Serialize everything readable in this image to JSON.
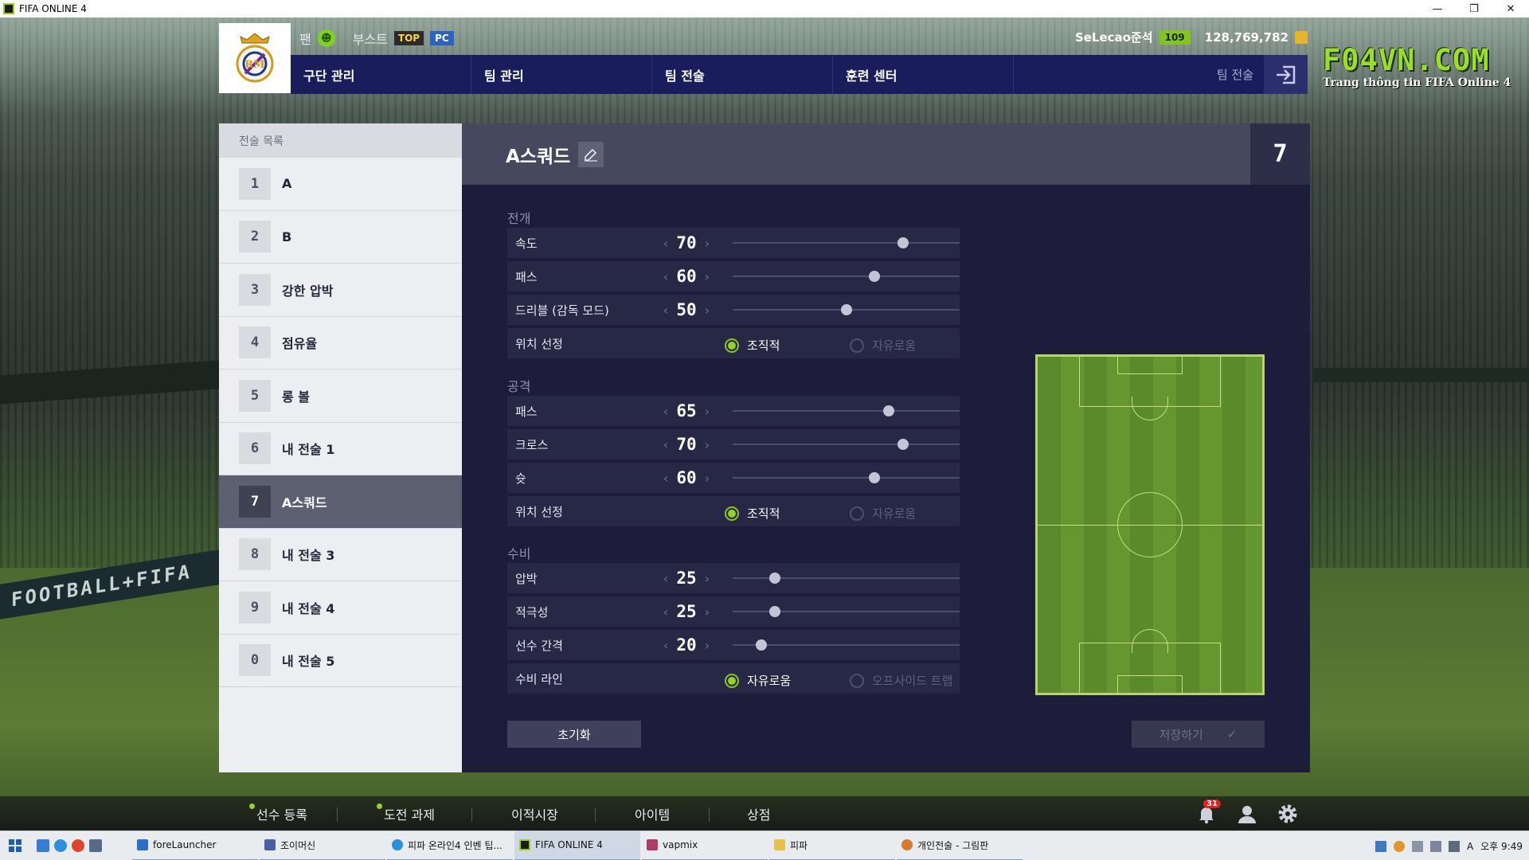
{
  "window": {
    "title": "FIFA ONLINE 4"
  },
  "header": {
    "fan_label": "팬",
    "boost_label": "부스트",
    "badge_top": "TOP",
    "badge_pc": "PC",
    "username": "SeLecao준석",
    "level": "109",
    "coins": "128,769,782",
    "nav": [
      "구단 관리",
      "팀 관리",
      "팀 전술",
      "훈련 센터"
    ],
    "nav_right": "팀 전술"
  },
  "brand": {
    "title": "F04VN.COM",
    "subtitle": "Trang thông tin FIFA Online 4"
  },
  "backdrop": {
    "board_text": "FOOTBALL+FIFA"
  },
  "tactic_list": {
    "header": "전술 목록",
    "items": [
      {
        "num": "1",
        "name": "A"
      },
      {
        "num": "2",
        "name": "B"
      },
      {
        "num": "3",
        "name": "강한 압박"
      },
      {
        "num": "4",
        "name": "점유율"
      },
      {
        "num": "5",
        "name": "롱 볼"
      },
      {
        "num": "6",
        "name": "내 전술 1"
      },
      {
        "num": "7",
        "name": "A스쿼드"
      },
      {
        "num": "8",
        "name": "내 전술 3"
      },
      {
        "num": "9",
        "name": "내 전술 4"
      },
      {
        "num": "0",
        "name": "내 전술 5"
      }
    ],
    "selected_index": 6
  },
  "main": {
    "title": "A스쿼드",
    "slot": "7",
    "sections": {
      "buildup": {
        "label": "전개",
        "rows": [
          {
            "label": "속도",
            "value": "70"
          },
          {
            "label": "패스",
            "value": "60"
          },
          {
            "label": "드리블 (감독 모드)",
            "value": "50"
          }
        ],
        "position": {
          "label": "위치 선정",
          "opt_on": "조직적",
          "opt_off": "자유로움"
        }
      },
      "attack": {
        "label": "공격",
        "rows": [
          {
            "label": "패스",
            "value": "65"
          },
          {
            "label": "크로스",
            "value": "70"
          },
          {
            "label": "슛",
            "value": "60"
          }
        ],
        "position": {
          "label": "위치 선정",
          "opt_on": "조직적",
          "opt_off": "자유로움"
        }
      },
      "defence": {
        "label": "수비",
        "rows": [
          {
            "label": "압박",
            "value": "25"
          },
          {
            "label": "적극성",
            "value": "25"
          },
          {
            "label": "선수 간격",
            "value": "20"
          }
        ],
        "line": {
          "label": "수비 라인",
          "opt_on": "자유로움",
          "opt_off": "오프사이드 트랩"
        }
      }
    },
    "reset_label": "초기화",
    "save_label": "저장하기"
  },
  "bottom_nav": {
    "items": [
      "선수 등록",
      "도전 과제",
      "이적시장",
      "아이템",
      "상점"
    ],
    "notifications": "31"
  },
  "taskbar": {
    "tasks": [
      "foreLauncher",
      "조이머신",
      "피파 온라인4 인벤 팁...",
      "FIFA ONLINE 4",
      "vapmix",
      "피파",
      "개인전술 - 그림판"
    ],
    "clock": "오후 9:49",
    "ime": "A"
  },
  "colors": {
    "nav": "#1a1d5c",
    "accent": "#8fd326",
    "panel": "#1d1d3b"
  }
}
